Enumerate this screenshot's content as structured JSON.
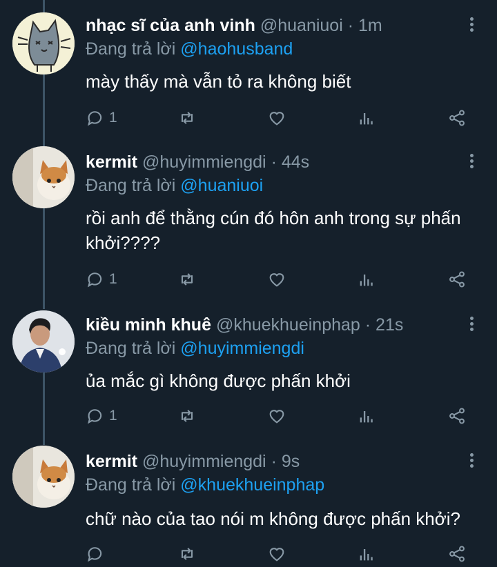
{
  "reply_prefix": "Đang trả lời",
  "tweets": [
    {
      "display_name": "nhạc sĩ của anh vinh",
      "handle": "@huaniuoi",
      "time": "· 1m",
      "reply_to": "@haohusband",
      "text": "mày thấy mà vẫn tỏ ra không biết",
      "reply_count": "1",
      "avatar_icon": "cat-cartoon-avatar"
    },
    {
      "display_name": "kermit",
      "handle": "@huyimmiengdi",
      "time": "· 44s",
      "reply_to": "@huaniuoi",
      "text": "rồi anh để thằng cún đó hôn anh trong sự phấn khởi????",
      "reply_count": "1",
      "avatar_icon": "cat-photo-avatar"
    },
    {
      "display_name": "kiều minh khuê",
      "handle": "@khuekhueinphap",
      "time": "· 21s",
      "reply_to": "@huyimmiengdi",
      "text": "ủa mắc gì không được phấn khởi",
      "reply_count": "1",
      "avatar_icon": "person-photo-avatar"
    },
    {
      "display_name": "kermit",
      "handle": "@huyimmiengdi",
      "time": "· 9s",
      "reply_to": "@khuekhueinphap",
      "text": "chữ nào của tao nói m không được phấn khởi?",
      "reply_count": "",
      "avatar_icon": "cat-photo-avatar"
    }
  ],
  "colors": {
    "background": "#15202b",
    "muted": "#8899a6",
    "link": "#1da1f2",
    "thread_line": "#3d5466"
  }
}
